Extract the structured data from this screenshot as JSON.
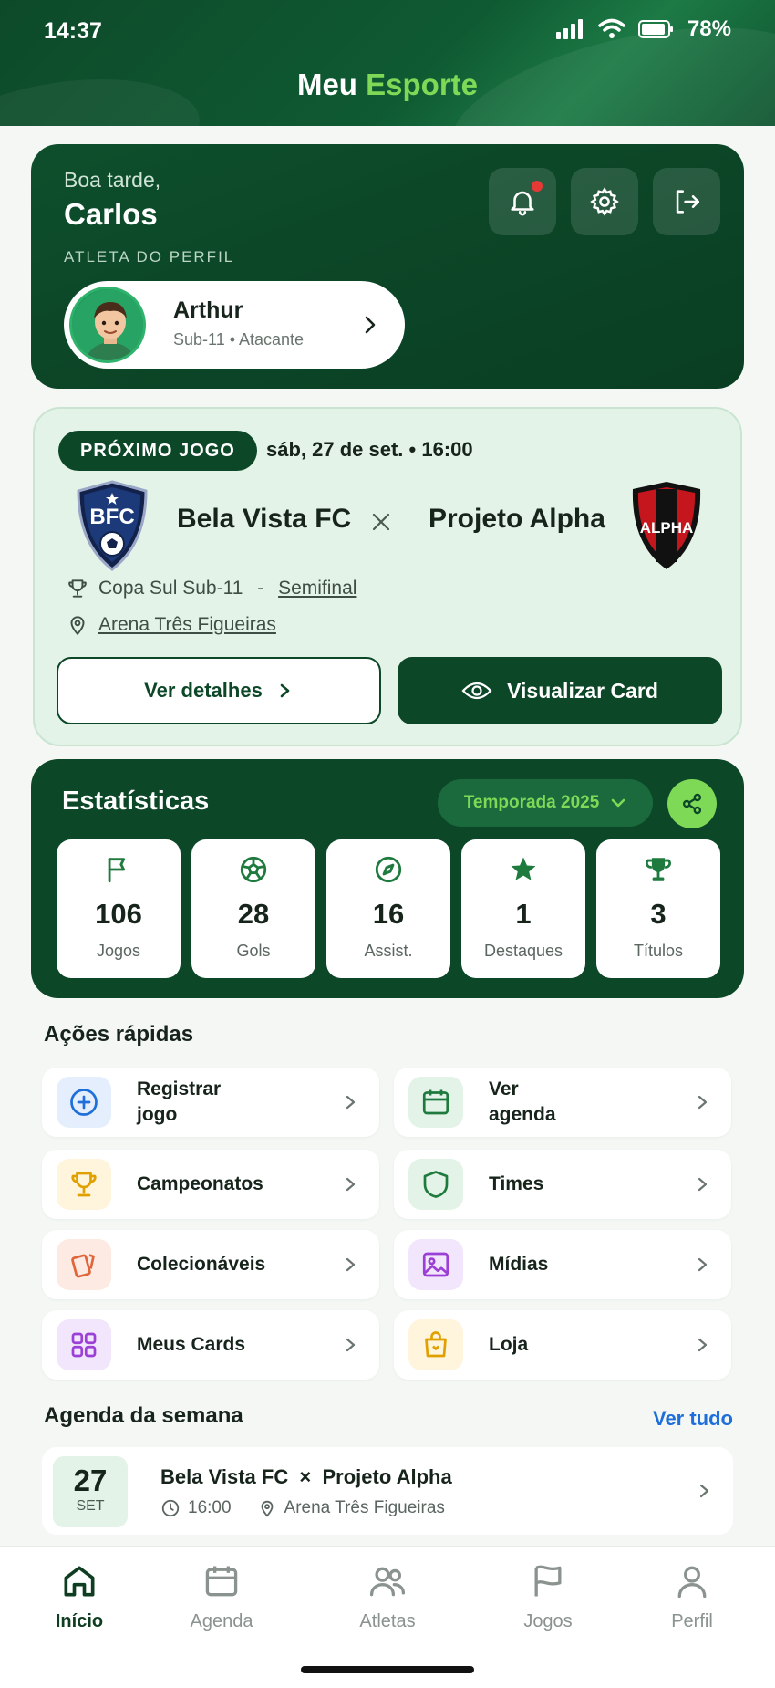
{
  "status_bar": {
    "time": "14:37",
    "battery": "78%"
  },
  "app": {
    "title_part1": "Meu ",
    "title_part2": "Esporte"
  },
  "greeting": {
    "hello": "Boa tarde,",
    "name": "Carlos",
    "role": "ATLETA DO PERFIL",
    "athlete_name": "Arthur",
    "athlete_sub": "Sub-11 • Atacante",
    "icons": [
      "bell-icon",
      "gear-icon",
      "logout-icon"
    ]
  },
  "next_match": {
    "badge": "PRÓXIMO JOGO",
    "date": "sáb, 27 de set. • 16:00",
    "home_team": "Bela Vista FC",
    "home_crest_text": "BFC",
    "versus": "×",
    "away_team": "Projeto Alpha",
    "away_crest_text": "ALPHA",
    "competition": "Copa Sul Sub-11",
    "separator": " - ",
    "stage": "Semifinal",
    "venue": "Arena Três Figueiras",
    "details_button": "Ver detalhes",
    "card_button": "Visualizar Card"
  },
  "stats": {
    "title": "Estatísticas",
    "season": "Temporada 2025",
    "items": [
      {
        "value": "106",
        "label": "Jogos",
        "icon": "flag-icon"
      },
      {
        "value": "28",
        "label": "Gols",
        "icon": "soccer-ball-icon"
      },
      {
        "value": "16",
        "label": "Assist.",
        "icon": "compass-icon"
      },
      {
        "value": "1",
        "label": "Destaques",
        "icon": "star-icon"
      },
      {
        "value": "3",
        "label": "Títulos",
        "icon": "trophy-icon"
      }
    ]
  },
  "quick_actions": {
    "title": "Ações rápidas",
    "items": [
      {
        "label": "Registrar jogo",
        "icon": "plus-circle-icon"
      },
      {
        "label": "Ver agenda",
        "icon": "calendar-icon"
      },
      {
        "label": "Campeonatos",
        "icon": "trophy-icon"
      },
      {
        "label": "Times",
        "icon": "shield-icon"
      },
      {
        "label": "Colecionáveis",
        "icon": "cards-icon"
      },
      {
        "label": "Mídias",
        "icon": "image-icon"
      },
      {
        "label": "Meus Cards",
        "icon": "grid-icon"
      },
      {
        "label": "Loja",
        "icon": "shopping-bag-icon"
      }
    ]
  },
  "week": {
    "title": "Agenda da semana",
    "see_all": "Ver tudo",
    "event": {
      "day": "27",
      "month": "SET",
      "title": "Bela Vista FC  ×  Projeto Alpha",
      "time": "16:00",
      "venue": "Arena Três Figueiras"
    }
  },
  "nav": [
    {
      "label": "Início",
      "icon": "home-icon",
      "active": true
    },
    {
      "label": "Agenda",
      "icon": "calendar-icon"
    },
    {
      "label": "Atletas",
      "icon": "users-icon"
    },
    {
      "label": "Jogos",
      "icon": "flag-icon"
    },
    {
      "label": "Perfil",
      "icon": "user-icon"
    }
  ],
  "colors": {
    "primary": "#0c4727",
    "accent": "#7ed957",
    "link": "#1e6fd9"
  }
}
